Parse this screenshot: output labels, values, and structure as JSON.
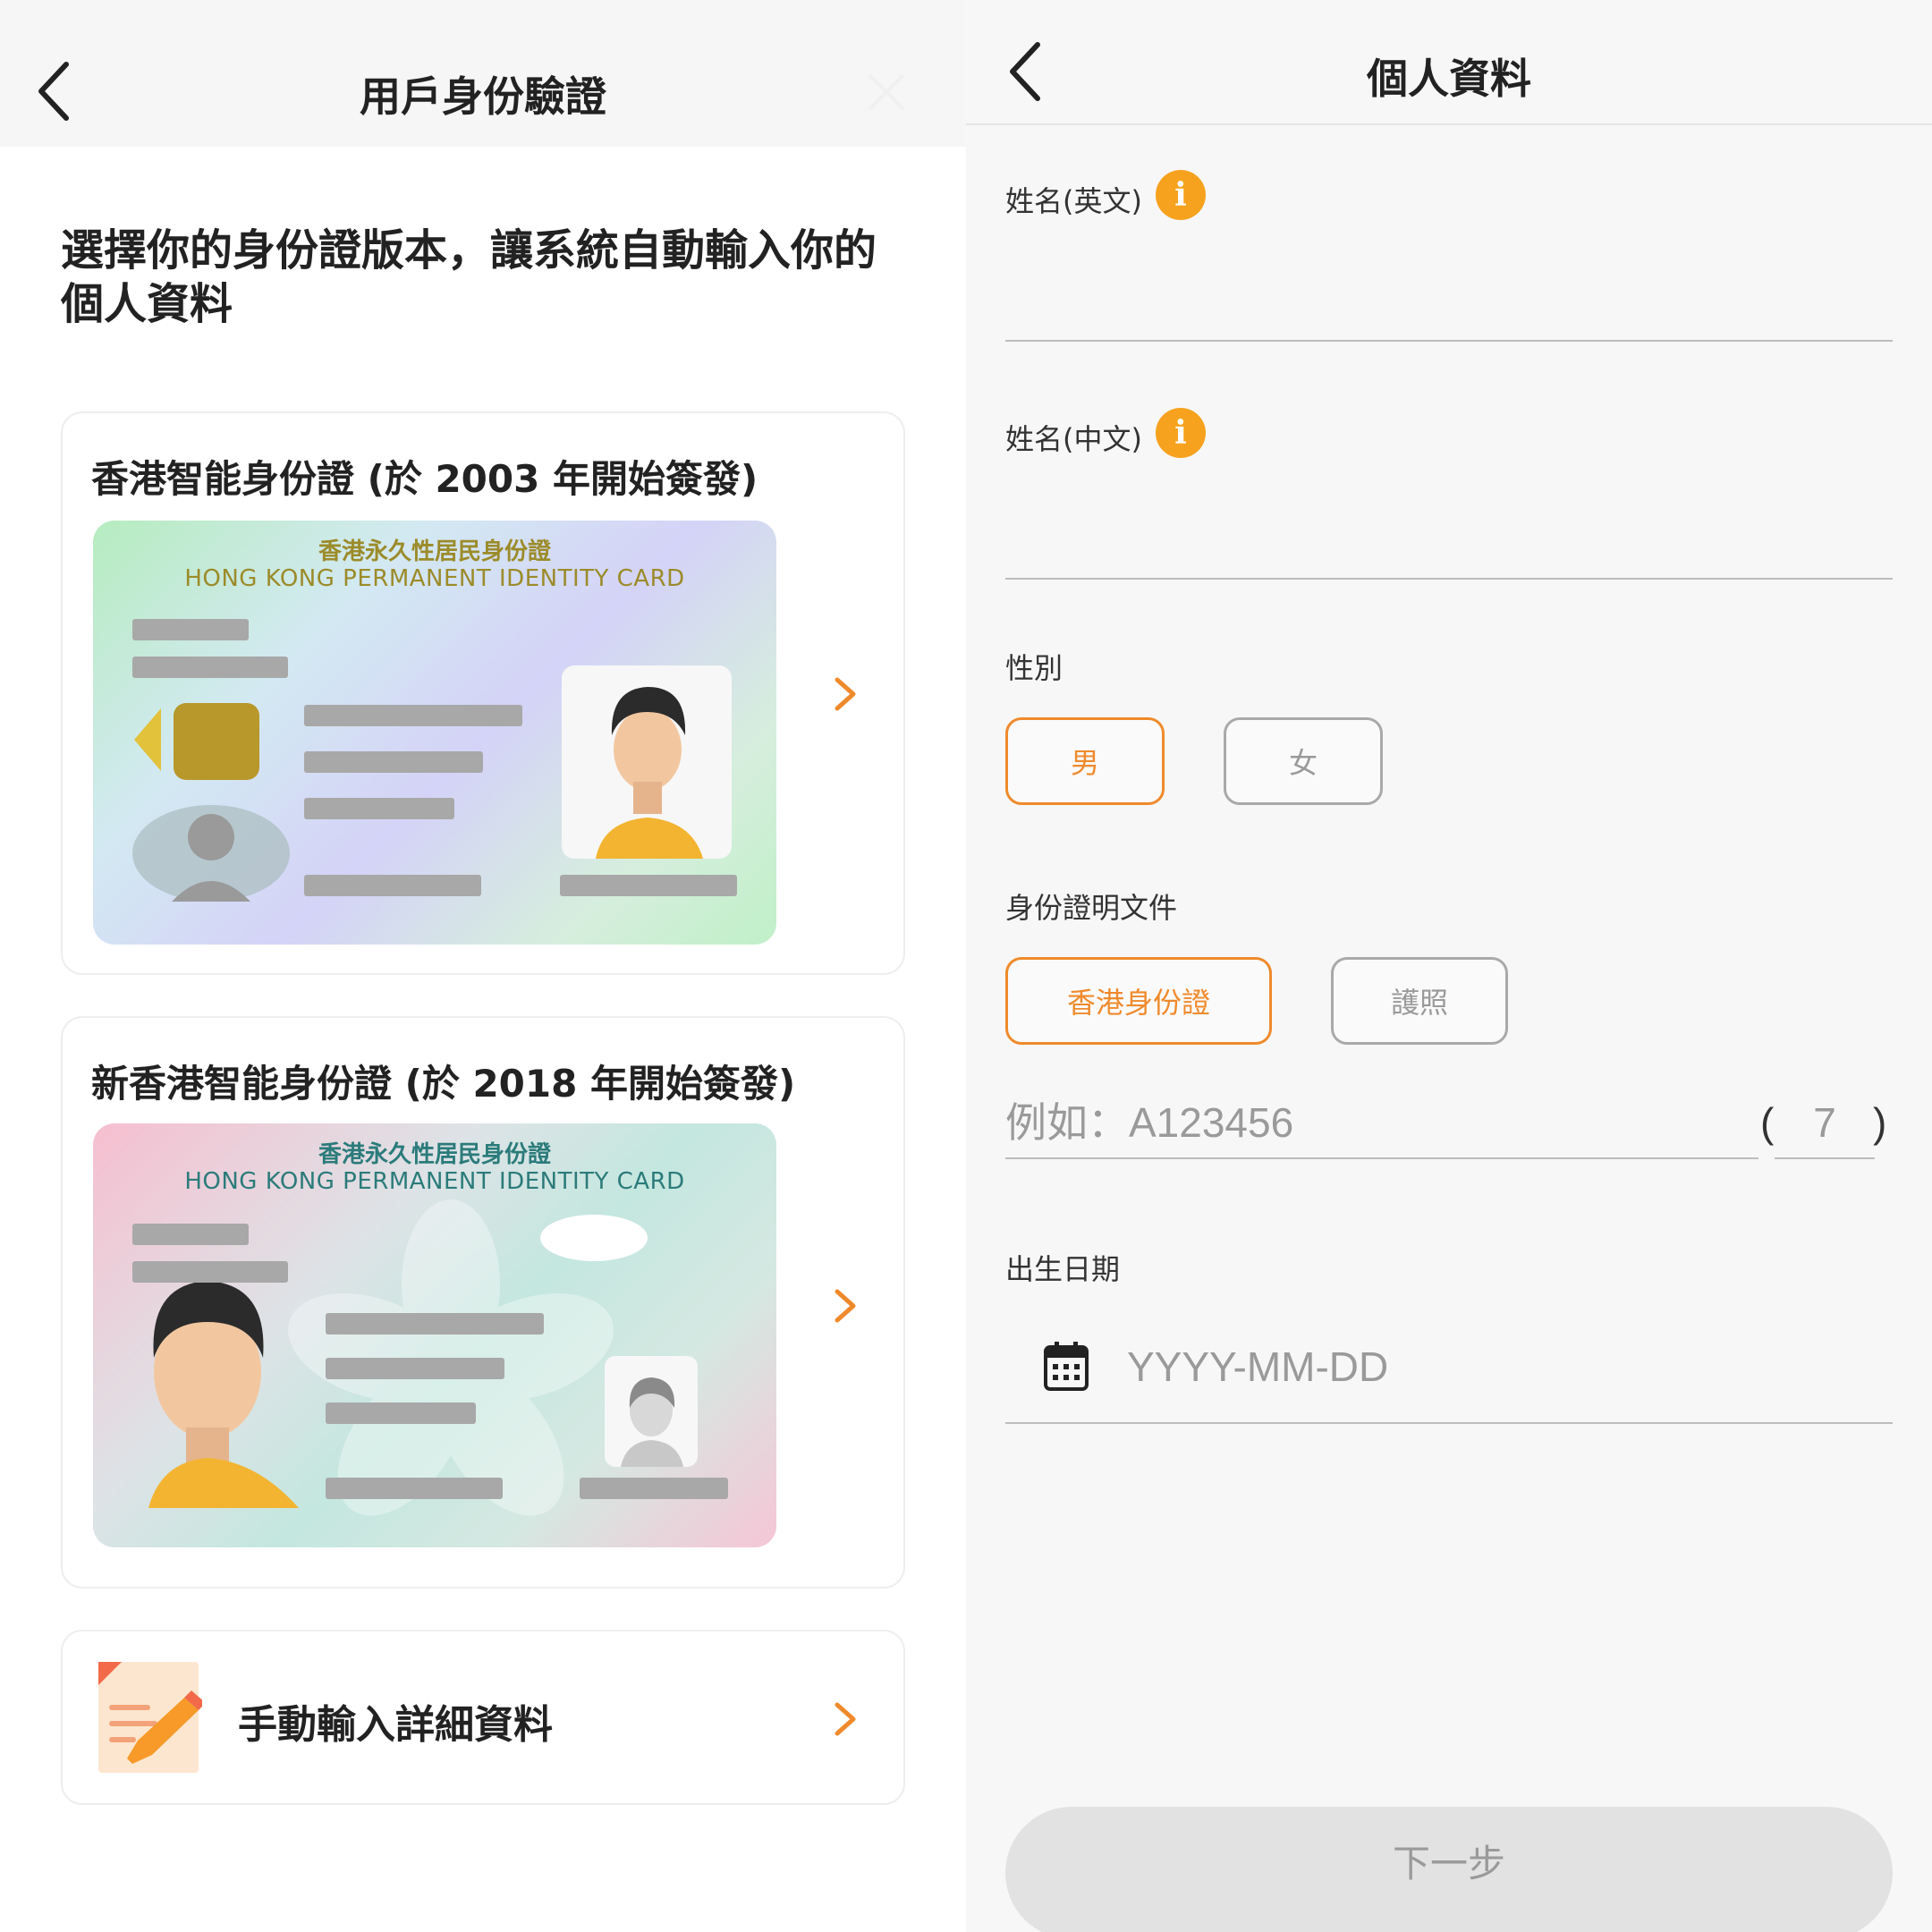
{
  "left": {
    "header": {
      "title": "用戶身份驗證"
    },
    "intro": "選擇你的身份證版本，讓系統自動輸入你的個人資料",
    "cards": [
      {
        "title": "香港智能身份證 (於 2003 年開始簽發)",
        "card_zh": "香港永久性居民身份證",
        "card_en": "HONG KONG PERMANENT IDENTITY CARD"
      },
      {
        "title": "新香港智能身份證 (於 2018 年開始簽發)",
        "card_zh": "香港永久性居民身份證",
        "card_en": "HONG KONG PERMANENT IDENTITY CARD"
      }
    ],
    "manual": {
      "label": "手動輸入詳細資料"
    }
  },
  "right": {
    "header": {
      "title": "個人資料"
    },
    "name_en": {
      "label": "姓名(英文)",
      "info": "i",
      "value": ""
    },
    "name_zh": {
      "label": "姓名(中文)",
      "info": "i",
      "value": ""
    },
    "gender": {
      "label": "性別",
      "options": [
        "男",
        "女"
      ],
      "selected": "男"
    },
    "doc_type": {
      "label": "身份證明文件",
      "options": [
        "香港身份證",
        "護照"
      ],
      "selected": "香港身份證"
    },
    "id_number": {
      "placeholder": "例如：A123456",
      "check_open": "(",
      "check_placeholder": "7",
      "check_close": ")"
    },
    "dob": {
      "label": "出生日期",
      "placeholder": "YYYY-MM-DD"
    },
    "next_button": "下一步"
  },
  "colors": {
    "accent": "#ef8a2c",
    "info": "#f6a21e",
    "disabled_button": "#e2e2e2"
  }
}
